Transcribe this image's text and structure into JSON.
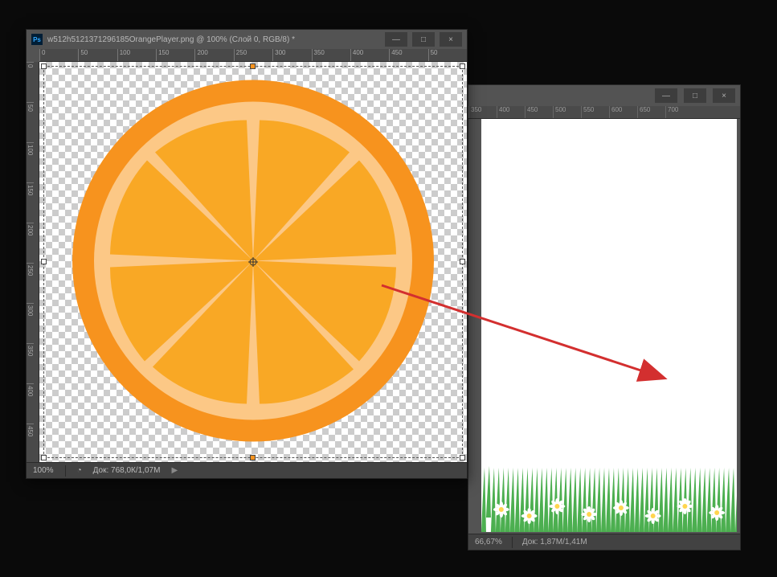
{
  "fg_window": {
    "title": "w512h5121371296185OrangePlayer.png @ 100% (Слой 0, RGB/8) *",
    "ps_icon": "Ps",
    "zoom": "100%",
    "doc_info": "Док: 768,0К/1,07М",
    "ruler_top": [
      "0",
      "50",
      "100",
      "150",
      "200",
      "250",
      "300",
      "350",
      "400",
      "450",
      "50"
    ],
    "ruler_left": [
      "0",
      "50",
      "100",
      "150",
      "200",
      "250",
      "300",
      "350",
      "400",
      "450"
    ]
  },
  "bg_window": {
    "zoom": "66,67%",
    "doc_info": "Док: 1,87М/1,41М",
    "ruler_top": [
      "350",
      "400",
      "450",
      "500",
      "550",
      "600",
      "650",
      "700"
    ]
  },
  "colors": {
    "orange_rind": "#f7931e",
    "orange_pith": "#fcc886",
    "orange_segment": "#f9a825"
  },
  "win_buttons": {
    "minimize": "—",
    "maximize": "□",
    "close": "×"
  },
  "icons": {
    "arrow_play": "▶"
  }
}
